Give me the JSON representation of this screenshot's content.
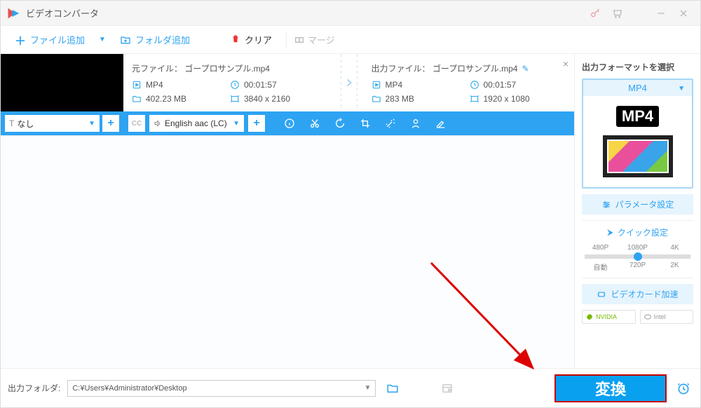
{
  "app": {
    "title": "ビデオコンバータ"
  },
  "toolbar": {
    "add_file": "ファイル追加",
    "add_folder": "フォルダ追加",
    "clear": "クリア",
    "merge": "マージ"
  },
  "file": {
    "src_label": "元ファイル：",
    "src_name": "ゴープロサンプル.mp4",
    "src_fmt": "MP4",
    "src_dur": "00:01:57",
    "src_size": "402.23 MB",
    "src_res": "3840 x 2160",
    "out_label": "出力ファイル：",
    "out_name": "ゴープロサンプル.mp4",
    "out_fmt": "MP4",
    "out_dur": "00:01:57",
    "out_size": "283 MB",
    "out_res": "1920 x 1080"
  },
  "controls": {
    "subtitle": "なし",
    "audio": "English aac (LC)"
  },
  "side": {
    "title": "出力フォーマットを選択",
    "format": "MP4",
    "badge": "MP4",
    "param": "パラメータ設定",
    "quick": "クイック設定",
    "res": {
      "r1": "480P",
      "r2": "1080P",
      "r3": "4K",
      "r4": "自動",
      "r5": "720P",
      "r6": "2K"
    },
    "gpu": "ビデオカード加速",
    "nvidia": "NVIDIA",
    "intel": "Intel"
  },
  "footer": {
    "label": "出力フォルダ:",
    "path": "C:¥Users¥Administrator¥Desktop",
    "convert": "変換"
  }
}
